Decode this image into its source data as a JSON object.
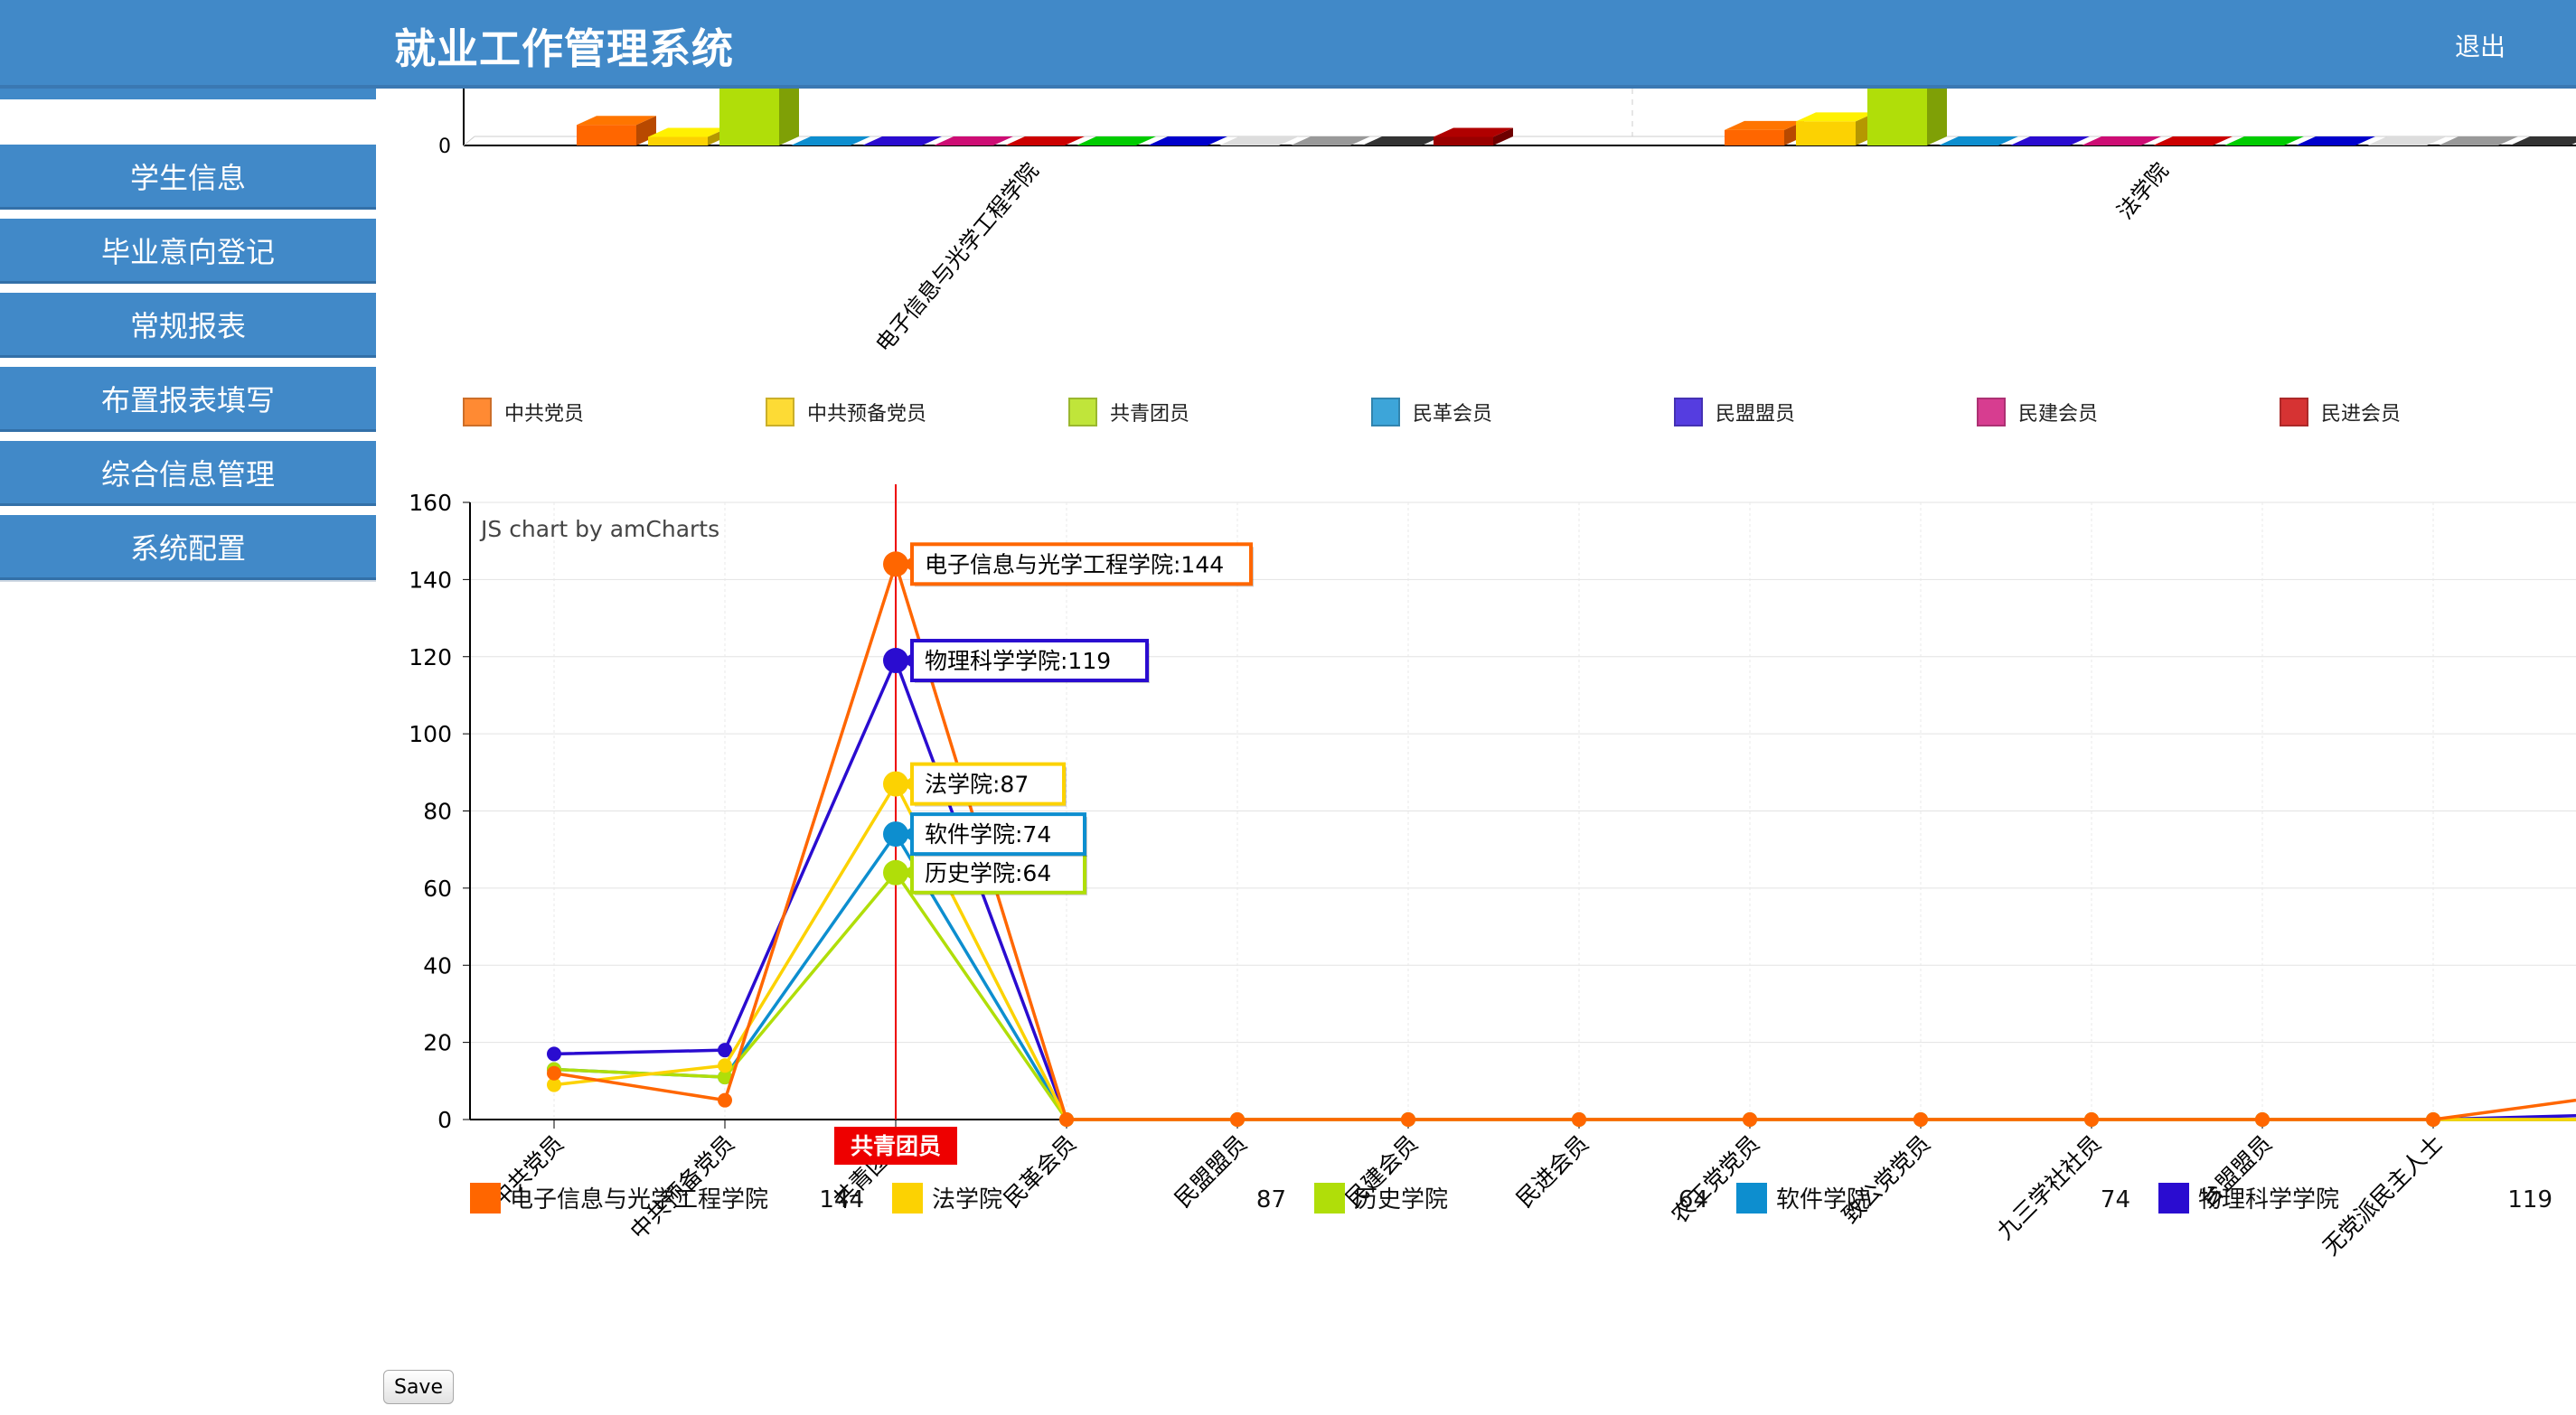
{
  "header": {
    "title": "就业工作管理系统",
    "logout_label": "退出"
  },
  "sidebar": {
    "items": [
      {
        "label": "学生信息"
      },
      {
        "label": "毕业意向登记"
      },
      {
        "label": "常规报表"
      },
      {
        "label": "布置报表填写"
      },
      {
        "label": "综合信息管理"
      },
      {
        "label": "系统配置"
      }
    ]
  },
  "colors": {
    "header_bg": "#4189c8",
    "accent": "#4189c8"
  },
  "chart_data": [
    {
      "type": "bar",
      "title": "",
      "categories": [
        "电子信息与光学工程学院",
        "法学院"
      ],
      "ylim": [
        0,
        160
      ],
      "y_ticks_visible": [
        0
      ],
      "series": [
        {
          "name": "中共党员",
          "color": "#ff6600",
          "values": [
            12,
            9
          ]
        },
        {
          "name": "中共预备党员",
          "color": "#fcd202",
          "values": [
            5,
            14
          ]
        },
        {
          "name": "共青团员",
          "color": "#b0de09",
          "values": [
            144,
            87
          ]
        },
        {
          "name": "民革会员",
          "color": "#0d8ecf",
          "values": [
            0,
            0
          ]
        },
        {
          "name": "民盟盟员",
          "color": "#2a0cd0",
          "values": [
            0,
            0
          ]
        },
        {
          "name": "民建会员",
          "color": "#cd0d74",
          "values": [
            0,
            0
          ]
        },
        {
          "name": "民进会员",
          "color": "#cc0000",
          "values": [
            0,
            0
          ]
        },
        {
          "name": "",
          "color": "#00cc00",
          "values": [
            0,
            0
          ]
        },
        {
          "name": "",
          "color": "#0000cc",
          "values": [
            0,
            0
          ]
        },
        {
          "name": "",
          "color": "#dddddd",
          "values": [
            0,
            0
          ]
        },
        {
          "name": "",
          "color": "#999999",
          "values": [
            0,
            0
          ]
        },
        {
          "name": "",
          "color": "#333333",
          "values": [
            0,
            0
          ]
        },
        {
          "name": "",
          "color": "#990000",
          "values": [
            5,
            0
          ]
        }
      ],
      "legend": [
        {
          "label": "中共党员",
          "color": "#ff8a33"
        },
        {
          "label": "中共预备党员",
          "color": "#fddb35"
        },
        {
          "label": "共青团员",
          "color": "#c0e53a"
        },
        {
          "label": "民革会员",
          "color": "#3da5d9"
        },
        {
          "label": "民盟盟员",
          "color": "#553de0"
        },
        {
          "label": "民建会员",
          "color": "#d73d90"
        },
        {
          "label": "民进会员",
          "color": "#d63333"
        }
      ]
    },
    {
      "type": "line",
      "title": "",
      "credit": "JS chart by amCharts",
      "categories": [
        "中共党员",
        "中共预备党员",
        "共青团员",
        "民革会员",
        "民盟盟员",
        "民建会员",
        "民进会员",
        "农工党党员",
        "致公党党员",
        "九三学社社员",
        "台盟盟员",
        "无党派民主人士"
      ],
      "ylim": [
        0,
        160
      ],
      "yticks": [
        0,
        20,
        40,
        60,
        80,
        100,
        120,
        140,
        160
      ],
      "cursor_category": "共青团员",
      "series": [
        {
          "name": "电子信息与光学工程学院",
          "color": "#ff6600",
          "values": [
            12,
            5,
            144,
            0,
            0,
            0,
            0,
            0,
            0,
            0,
            0,
            0
          ],
          "tail": 5,
          "balloon": "电子信息与光学工程学院:144",
          "legend_value": "144"
        },
        {
          "name": "法学院",
          "color": "#fcd202",
          "values": [
            9,
            14,
            87,
            0,
            0,
            0,
            0,
            0,
            0,
            0,
            0,
            0
          ],
          "tail": 0,
          "balloon": "法学院:87",
          "legend_value": "87"
        },
        {
          "name": "历史学院",
          "color": "#b0de09",
          "values": [
            13,
            11,
            64,
            0,
            0,
            0,
            0,
            0,
            0,
            0,
            0,
            0
          ],
          "tail": 0,
          "balloon": "历史学院:64",
          "legend_value": "64"
        },
        {
          "name": "软件学院",
          "color": "#0d8ecf",
          "values": [
            13,
            11,
            74,
            0,
            0,
            0,
            0,
            0,
            0,
            0,
            0,
            0
          ],
          "tail": 0,
          "balloon": "软件学院:74",
          "legend_value": "74"
        },
        {
          "name": "物理科学学院",
          "color": "#2a0cd0",
          "values": [
            17,
            18,
            119,
            0,
            0,
            0,
            0,
            0,
            0,
            0,
            0,
            0
          ],
          "tail": 1,
          "balloon": "物理科学学院:119",
          "legend_value": "119"
        }
      ]
    }
  ],
  "save_label": "Save"
}
